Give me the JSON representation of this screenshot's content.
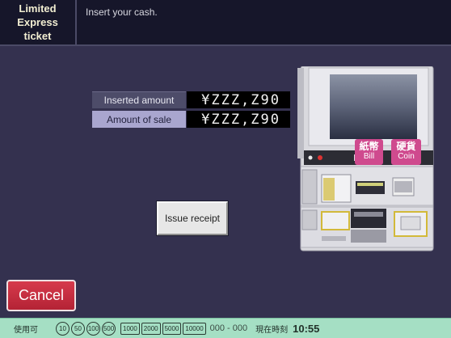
{
  "header": {
    "title": "Limited\nExpress\nticket",
    "message": "Insert your cash."
  },
  "amounts": {
    "inserted_label": "Inserted amount",
    "inserted_value": "¥ZZZ,Z90",
    "sale_label": "Amount of sale",
    "sale_value": "¥ZZZ,Z90"
  },
  "buttons": {
    "issue_receipt": "Issue receipt",
    "cancel": "Cancel"
  },
  "machine": {
    "bill_jp": "紙幣",
    "bill_en": "Bill",
    "coin_jp": "硬貨",
    "coin_en": "Coin"
  },
  "status_bar": {
    "usable_label": "使用可",
    "coins": [
      "10",
      "50",
      "100",
      "500"
    ],
    "bills": [
      "1000",
      "2000",
      "5000",
      "10000"
    ],
    "bill_range": "000 - 000",
    "time_label": "現在時刻",
    "time_value": "10:55"
  },
  "colors": {
    "background": "#34314f",
    "header": "#16162a",
    "cancel": "#c12c3e",
    "status_bar": "#a5dfc4",
    "badge": "#cf4a8e"
  }
}
